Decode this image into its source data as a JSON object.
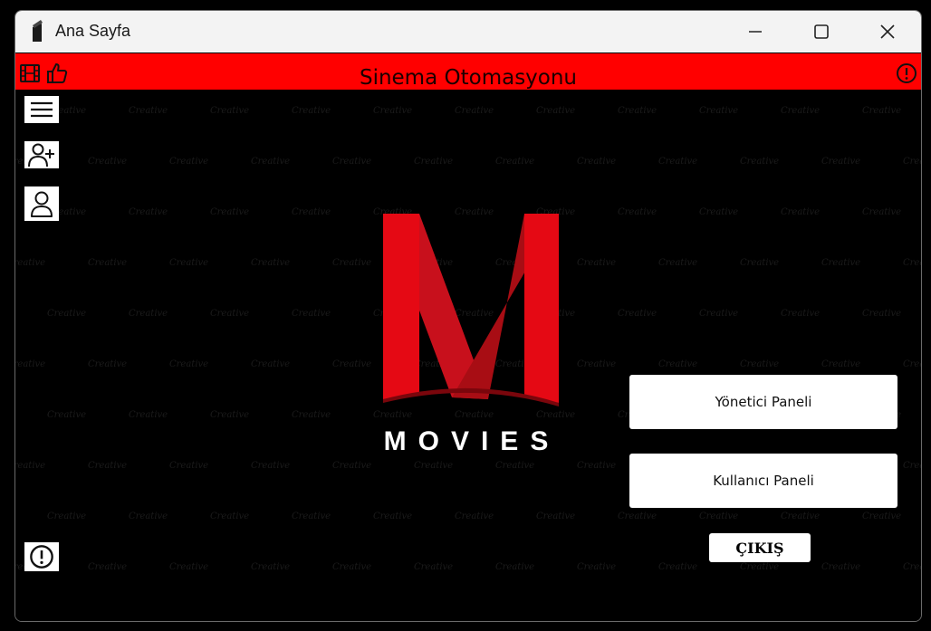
{
  "window": {
    "title": "Ana Sayfa",
    "controls": {
      "minimize": "minimize-icon",
      "maximize": "maximize-icon",
      "close": "close-icon"
    }
  },
  "header": {
    "title": "Sinema Otomasyonu",
    "left_icons": [
      "film-icon",
      "thumbs-up-icon"
    ],
    "right_icon": "alert-circle-icon",
    "background": "#ff0000"
  },
  "sidebar": {
    "items": [
      {
        "name": "menu",
        "icon": "hamburger-menu-icon"
      },
      {
        "name": "add-user",
        "icon": "add-user-icon"
      },
      {
        "name": "user",
        "icon": "user-icon"
      }
    ],
    "bottom_item": {
      "name": "info",
      "icon": "alert-circle-icon"
    }
  },
  "logo": {
    "letter": "M",
    "wordmark": "MOVIES",
    "color": "#e50914"
  },
  "watermark": "Creative",
  "buttons": {
    "admin_panel": "Yönetici Paneli",
    "user_panel": "Kullanıcı Paneli",
    "exit": "ÇIKIŞ"
  }
}
